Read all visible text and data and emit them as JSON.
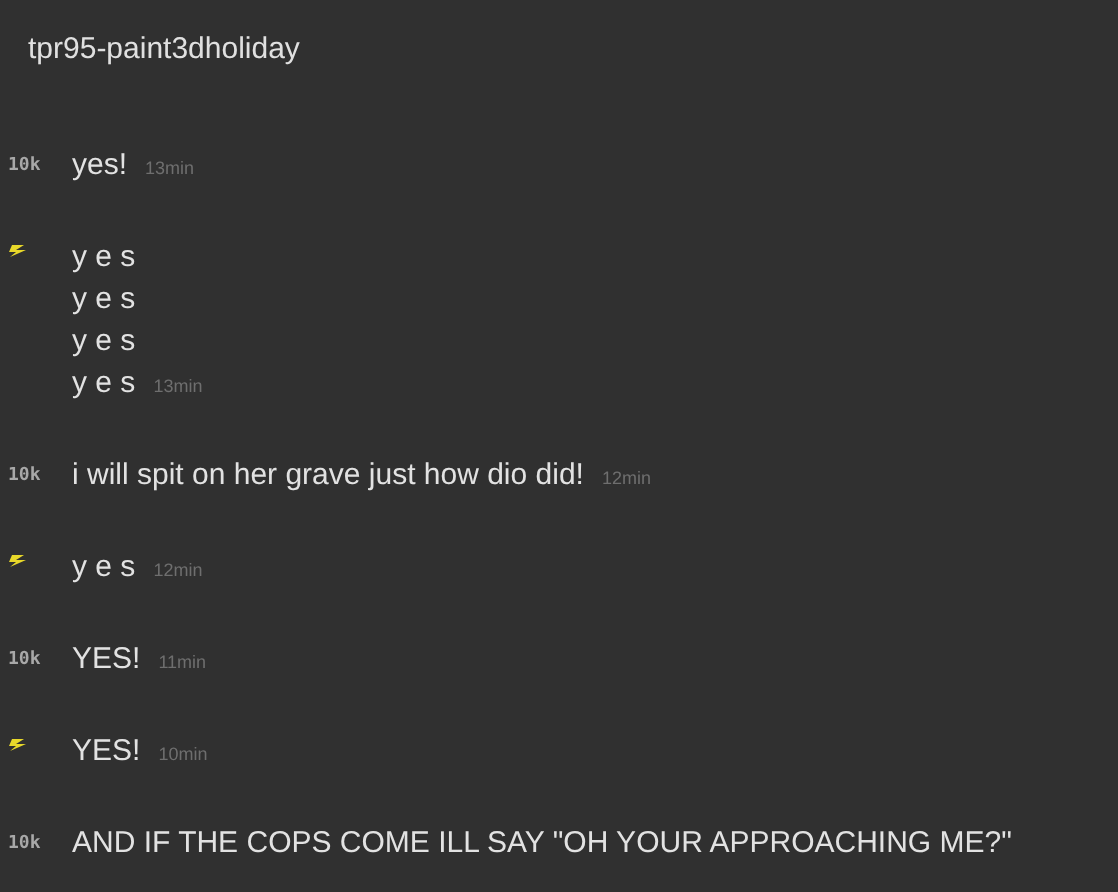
{
  "title": "tpr95-paint3dholiday",
  "messages": [
    {
      "avatar": {
        "kind": "tag",
        "text": "10k"
      },
      "lines": [
        "yes!"
      ],
      "time": "13min"
    },
    {
      "avatar": {
        "kind": "bolt"
      },
      "lines": [
        "y e s",
        "y e s",
        "y e s",
        "y e s"
      ],
      "time": "13min"
    },
    {
      "avatar": {
        "kind": "tag",
        "text": "10k"
      },
      "lines": [
        "i will spit on her grave just how dio did!"
      ],
      "time": "12min"
    },
    {
      "avatar": {
        "kind": "bolt"
      },
      "lines": [
        "y e s"
      ],
      "time": "12min"
    },
    {
      "avatar": {
        "kind": "tag",
        "text": "10k"
      },
      "lines": [
        "YES!"
      ],
      "time": "11min"
    },
    {
      "avatar": {
        "kind": "bolt"
      },
      "lines": [
        "YES!"
      ],
      "time": "10min"
    },
    {
      "avatar": {
        "kind": "tag",
        "text": "10k"
      },
      "lines": [
        "AND IF THE COPS COME ILL SAY \"OH YOUR APPROACHING ME?\""
      ]
    }
  ]
}
